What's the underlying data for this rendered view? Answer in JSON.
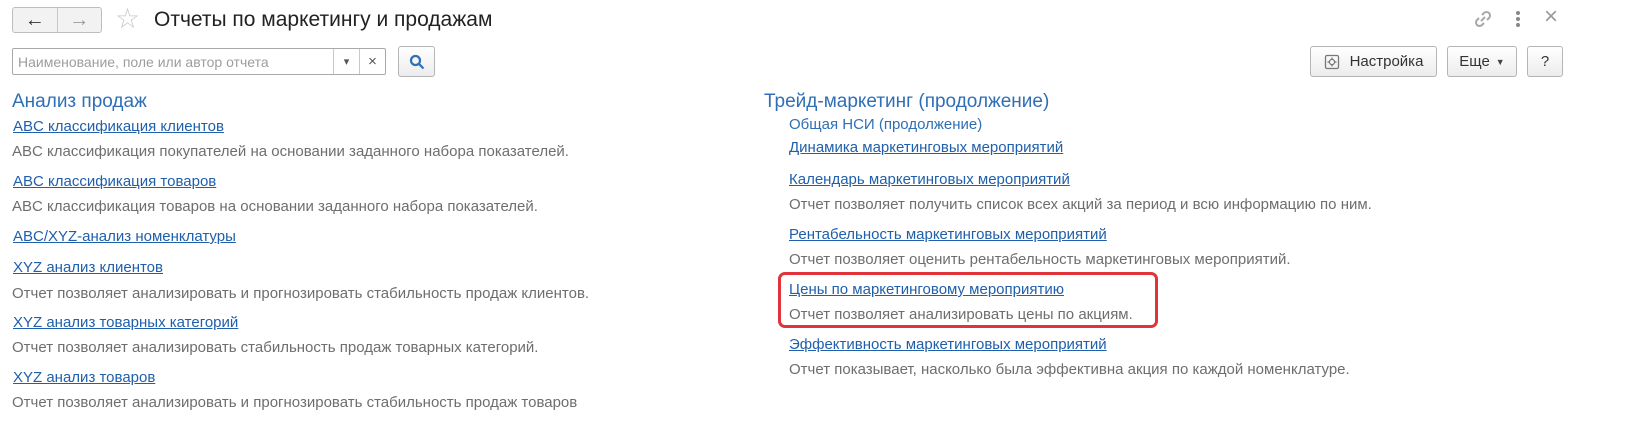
{
  "header": {
    "back_icon": "arrow-left-icon",
    "forward_icon": "arrow-right-icon",
    "favorite_icon": "star-icon",
    "title": "Отчеты по маркетингу и продажам",
    "link_icon": "link-icon",
    "more_icon": "vertical-dots-icon"
  },
  "search": {
    "placeholder": "Наименование, поле или автор отчета",
    "value": ""
  },
  "toolbar": {
    "settings_label": "Настройка",
    "more_label": "Еще",
    "help_label": "?"
  },
  "left": {
    "section_title": "Анализ продаж",
    "reports": [
      {
        "title": "ABC классификация клиентов",
        "desc": "ABC классификация покупателей на основании заданного набора показателей."
      },
      {
        "title": "ABC классификация товаров",
        "desc": "ABC классификация товаров на основании заданного набора показателей."
      },
      {
        "title": "ABC/XYZ-анализ номенклатуры",
        "desc": ""
      },
      {
        "title": "XYZ анализ клиентов",
        "desc": "Отчет позволяет анализировать и прогнозировать стабильность продаж клиентов."
      },
      {
        "title": "XYZ анализ товарных категорий",
        "desc": "Отчет позволяет анализировать стабильность продаж товарных категорий."
      },
      {
        "title": "XYZ анализ товаров",
        "desc": "Отчет позволяет анализировать и прогнозировать стабильность продаж товаров"
      }
    ]
  },
  "right": {
    "section_title": "Трейд-маркетинг (продолжение)",
    "subsection_title": "Общая НСИ (продолжение)",
    "reports": [
      {
        "title": "Динамика маркетинговых мероприятий",
        "desc": ""
      },
      {
        "title": "Календарь маркетинговых мероприятий",
        "desc": "Отчет позволяет получить список всех акций за период и всю информацию по ним."
      },
      {
        "title": "Рентабельность маркетинговых мероприятий",
        "desc": "Отчет позволяет оценить рентабельность маркетинговых мероприятий."
      },
      {
        "title": "Цены по маркетинговому мероприятию",
        "desc": "Отчет позволяет анализировать цены по акциям."
      },
      {
        "title": "Эффективность маркетинговых мероприятий",
        "desc": "Отчет показывает, насколько была эффективна акция по каждой номенклатуре."
      }
    ]
  },
  "colors": {
    "section": "#2f6fb5",
    "link": "#1f5fab",
    "description": "#6e6e6e",
    "highlight": "#e0333a"
  }
}
